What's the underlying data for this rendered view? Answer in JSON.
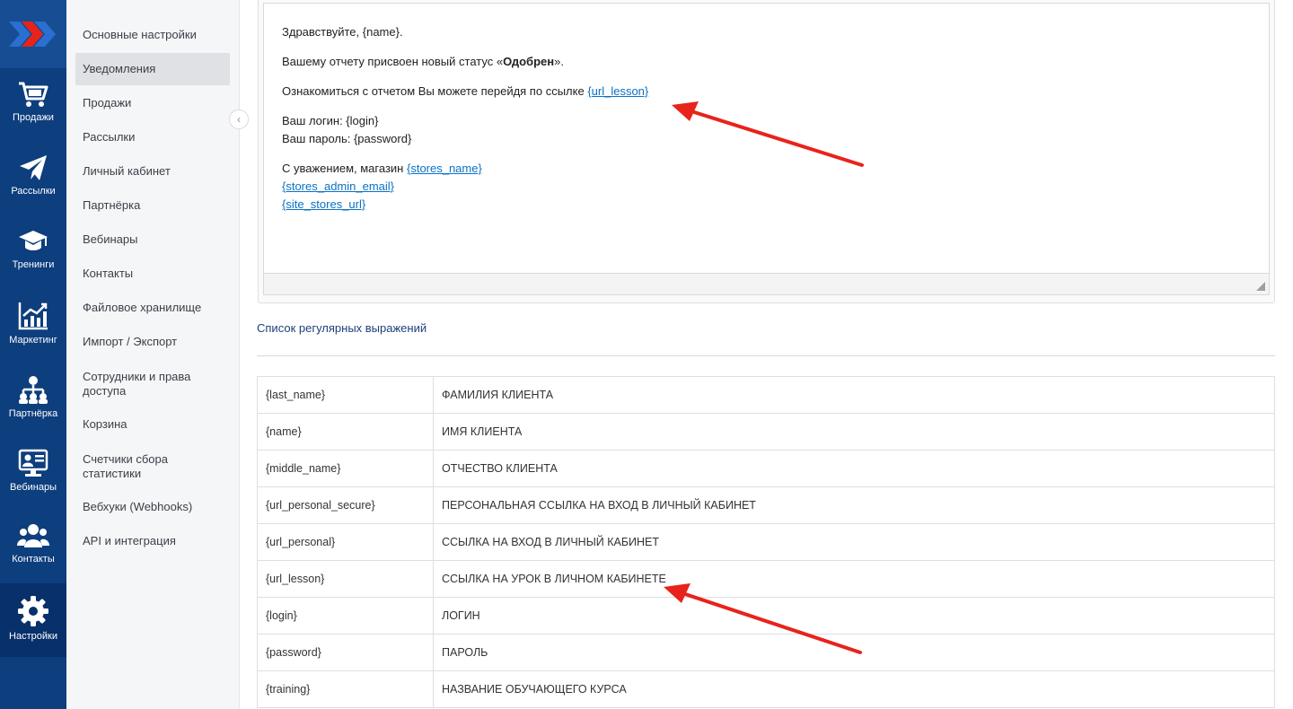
{
  "rail": {
    "items": [
      {
        "label": "Продажи",
        "icon": "cart-icon"
      },
      {
        "label": "Рассылки",
        "icon": "paper-plane-icon"
      },
      {
        "label": "Тренинги",
        "icon": "graduation-cap-icon"
      },
      {
        "label": "Маркетинг",
        "icon": "chart-up-icon"
      },
      {
        "label": "Партнёрка",
        "icon": "network-icon"
      },
      {
        "label": "Вебинары",
        "icon": "webinar-icon"
      },
      {
        "label": "Контакты",
        "icon": "users-icon"
      },
      {
        "label": "Настройки",
        "icon": "gear-icon"
      }
    ],
    "active": "Настройки"
  },
  "menu": {
    "items": [
      {
        "label": "Основные настройки"
      },
      {
        "label": "Уведомления"
      },
      {
        "label": "Продажи"
      },
      {
        "label": "Рассылки"
      },
      {
        "label": "Личный кабинет"
      },
      {
        "label": "Партнёрка"
      },
      {
        "label": "Вебинары"
      },
      {
        "label": "Контакты"
      },
      {
        "label": "Файловое хранилище"
      },
      {
        "label": "Импорт / Экспорт"
      },
      {
        "label": "Сотрудники и права доступа"
      },
      {
        "label": "Корзина"
      },
      {
        "label": "Счетчики сбора статистики"
      },
      {
        "label": "Вебхуки (Webhooks)"
      },
      {
        "label": "API и интеграция"
      }
    ],
    "active": "Уведомления"
  },
  "email": {
    "greeting": "Здравствуйте, {name}.",
    "status_prefix": "Вашему отчету присвоен новый статус «",
    "status_value": "Одобрен",
    "status_suffix": "».",
    "link_prefix": "Ознакомиться с отчетом Вы можете перейдя по ссылке ",
    "link_var": "{url_lesson}",
    "login_line": "Ваш логин: {login}",
    "password_line": "Ваш пароль: {password}",
    "signature_prefix": "С уважением, магазин ",
    "stores_name": "{stores_name}",
    "stores_admin_email": "{stores_admin_email}",
    "site_stores_url": "{site_stores_url}"
  },
  "regex_title": "Список регулярных выражений",
  "variables": [
    {
      "key": "{last_name}",
      "desc": "ФАМИЛИЯ КЛИЕНТА"
    },
    {
      "key": "{name}",
      "desc": "ИМЯ КЛИЕНТА"
    },
    {
      "key": "{middle_name}",
      "desc": "ОТЧЕСТВО КЛИЕНТА"
    },
    {
      "key": "{url_personal_secure}",
      "desc": "ПЕРСОНАЛЬНАЯ ССЫЛКА НА ВХОД В ЛИЧНЫЙ КАБИНЕТ"
    },
    {
      "key": "{url_personal}",
      "desc": "ССЫЛКА НА ВХОД В ЛИЧНЫЙ КАБИНЕТ"
    },
    {
      "key": "{url_lesson}",
      "desc": "ССЫЛКА НА УРОК В ЛИЧНОМ КАБИНЕТЕ"
    },
    {
      "key": "{login}",
      "desc": "ЛОГИН"
    },
    {
      "key": "{password}",
      "desc": "ПАРОЛЬ"
    },
    {
      "key": "{training}",
      "desc": "НАЗВАНИЕ ОБУЧАЮЩЕГО КУРСА"
    }
  ],
  "colors": {
    "rail_bg": "#0d3e7e",
    "rail_active": "#08306a",
    "link": "#0a72c4",
    "annotation_arrow": "#e8231b",
    "logo_red": "#e8231b",
    "logo_blue": "#2a6fd1"
  }
}
